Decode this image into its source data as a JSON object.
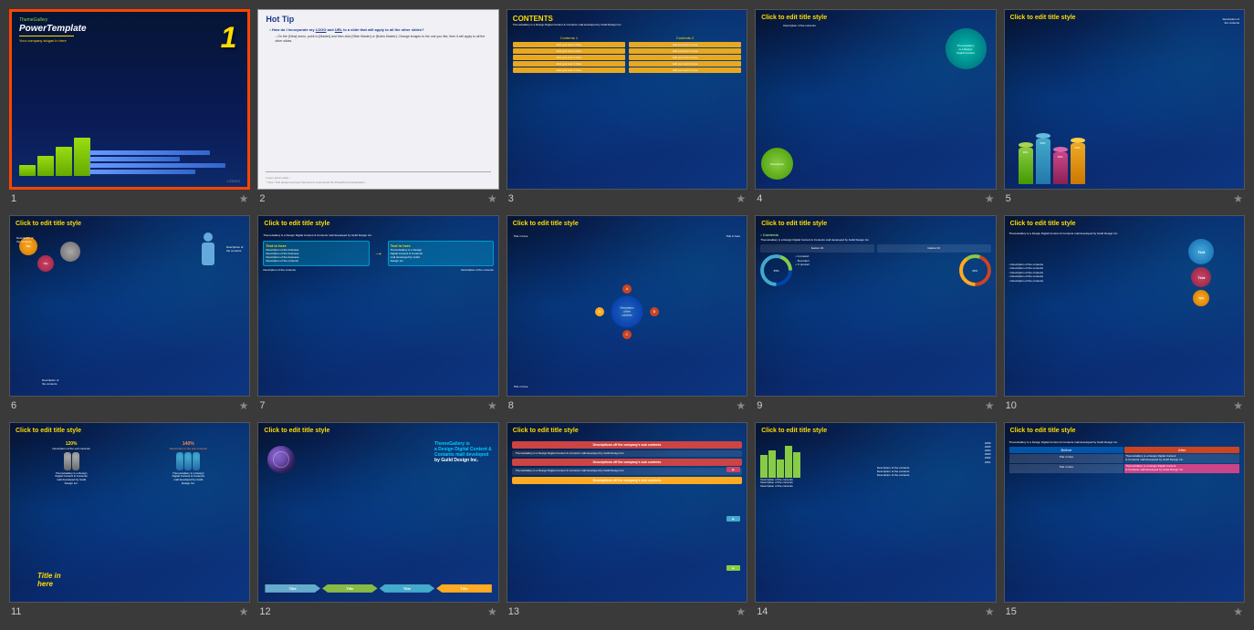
{
  "slides": [
    {
      "id": 1,
      "number": "1",
      "type": "title",
      "brand": "ThemeGallery",
      "title": "PowerTemplate",
      "tagline": "Your company slogan in here",
      "number_display": "1",
      "logo": "LOGO",
      "selected": true
    },
    {
      "id": 2,
      "number": "2",
      "type": "tip",
      "title": "Hot Tip",
      "content": "How do I Incorporate my LOGO and URL to a slide that will apply to all the other slides?",
      "sub": "On the [View] menu, point to [Master] and then click [Slide Master] or [Notes Master]. Change images to the one you like, then it will apply to all the other slides.",
      "selected": false
    },
    {
      "id": 3,
      "number": "3",
      "type": "contents",
      "title": "CONTENTS",
      "subtitle": "ThemeGallery is a Design Digital Content & Contents mall developed by Guild Design Inc.",
      "col1_title": "Contents 1",
      "col2_title": "Contents 2",
      "selected": false
    },
    {
      "id": 4,
      "number": "4",
      "type": "generic",
      "title": "Click to edit title style",
      "selected": false
    },
    {
      "id": 5,
      "number": "5",
      "type": "generic",
      "title": "Click to edit title style",
      "selected": false
    },
    {
      "id": 6,
      "number": "6",
      "type": "generic",
      "title": "Click to edit title style",
      "selected": false
    },
    {
      "id": 7,
      "number": "7",
      "type": "generic",
      "title": "Click to edit title style",
      "selected": false
    },
    {
      "id": 8,
      "number": "8",
      "type": "generic",
      "title": "Click to edit title style",
      "selected": false
    },
    {
      "id": 9,
      "number": "9",
      "type": "generic",
      "title": "Click to edit title style",
      "selected": false
    },
    {
      "id": 10,
      "number": "10",
      "type": "generic",
      "title": "Click to edit title style",
      "selected": false
    },
    {
      "id": 11,
      "number": "11",
      "type": "generic",
      "title": "Click to edit title style",
      "selected": false
    },
    {
      "id": 12,
      "number": "12",
      "type": "generic",
      "title": "Click to edit title style",
      "selected": false
    },
    {
      "id": 13,
      "number": "13",
      "type": "generic",
      "title": "Click to edit title style",
      "selected": false
    },
    {
      "id": 14,
      "number": "14",
      "type": "generic",
      "title": "Click to edit title style",
      "selected": false
    },
    {
      "id": 15,
      "number": "15",
      "type": "generic",
      "title": "Click to edit title style",
      "selected": false
    }
  ],
  "star_icon": "★",
  "colors": {
    "selected_border": "#ff4400",
    "bg_dark": "#3a3a3a",
    "slide_bg": "#0a2060",
    "yellow": "#ffdd00",
    "white": "#ffffff"
  }
}
